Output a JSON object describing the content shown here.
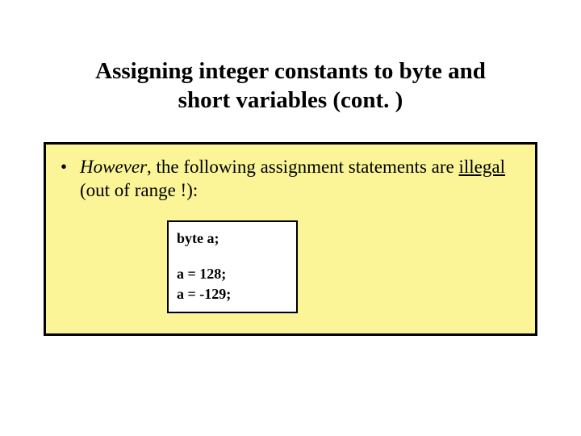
{
  "title_line1": "Assigning integer constants to byte and",
  "title_line2": "short variables (cont. )",
  "bullet": {
    "mark": "•",
    "however": "However",
    "text_mid": ", the following assignment statements are ",
    "illegal": "illegal",
    "text_tail": " (out of range !):"
  },
  "code": {
    "decl": "byte a;",
    "l1": "a = 128;",
    "l2": "a = -129;"
  }
}
